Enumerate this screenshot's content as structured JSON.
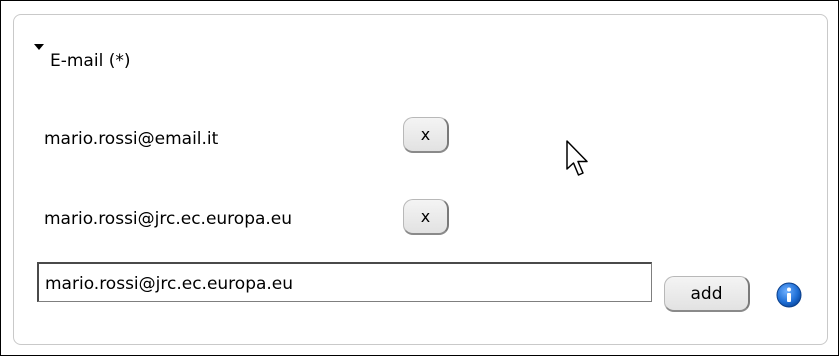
{
  "section": {
    "title": "E-mail (*)"
  },
  "emails": [
    {
      "address": "mario.rossi@email.it",
      "remove_label": "x"
    },
    {
      "address": "mario.rossi@jrc.ec.europa.eu",
      "remove_label": "x"
    }
  ],
  "new_email": {
    "value": "mario.rossi@jrc.ec.europa.eu",
    "add_label": "add"
  },
  "icons": {
    "toggle": "collapse-triangle-icon",
    "info": "info-icon",
    "cursor": "mouse-pointer-icon"
  },
  "colors": {
    "info_blue": "#1f6fd6"
  }
}
